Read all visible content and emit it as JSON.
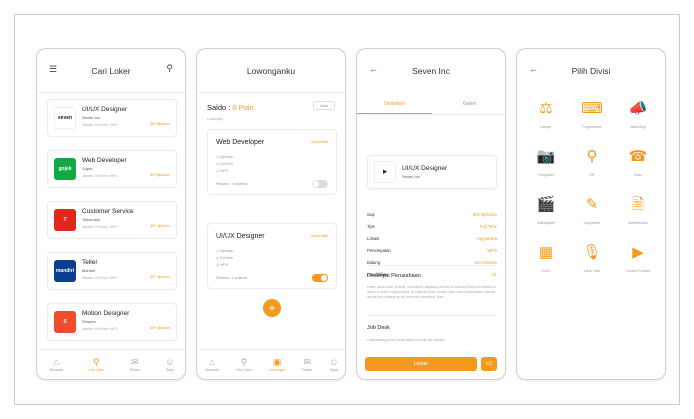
{
  "accent": "#f39a1e",
  "screen1": {
    "title": "Cari Loker",
    "filter_icon": "filter-icon",
    "search_icon": "search-icon",
    "jobs": [
      {
        "title": "UI/UX Designer",
        "company": "Seven Inc",
        "meta": "Jakarta  •  Full time  •  WFH",
        "salary": "IDR 5jt/bulan",
        "logo_color": "#ffffff",
        "logo_text": "seven"
      },
      {
        "title": "Web Developer",
        "company": "Gojek",
        "meta": "Jakarta  •  Full time  •  WFO",
        "salary": "IDR 8jt/bulan",
        "logo_color": "#12a843",
        "logo_text": "gojek"
      },
      {
        "title": "Customer Service",
        "company": "Telkomsel",
        "meta": "Jakarta  •  Full time  •  WFO",
        "salary": "IDR 4jt/bulan",
        "logo_color": "#e1261c",
        "logo_text": "T"
      },
      {
        "title": "Teller",
        "company": "Mandiri",
        "meta": "Jakarta  •  Full time  •  WFO",
        "salary": "IDR 4jt/bulan",
        "logo_color": "#0b3d91",
        "logo_text": "mandiri"
      },
      {
        "title": "Motion Designer",
        "company": "Shopee",
        "meta": "Jakarta  •  Full time  •  WFO",
        "salary": "IDR 6jt/bulan",
        "logo_color": "#ee4d2d",
        "logo_text": "S"
      }
    ],
    "nav": [
      "Beranda",
      "Cari Loker",
      "Pesan",
      "Saya"
    ]
  },
  "screen2": {
    "title": "Lowonganku",
    "saldo_label": "Saldo : ",
    "saldo_value": "0 Poin",
    "ubah_label": "Ubah",
    "section_label": "Lowongan",
    "vacancies": [
      {
        "title": "Web Developer",
        "status": "Lihat Detail",
        "rows": [
          "8jt/bulan",
          "Full time",
          "WFO"
        ],
        "footer": "Pelamar : 0 pelamar",
        "active": false
      },
      {
        "title": "UI/UX Designer",
        "status": "Lihat Detail",
        "rows": [
          "5jt/bulan",
          "Full time",
          "WFH"
        ],
        "footer": "Pelamar : 0 pelamar",
        "active": true
      }
    ],
    "fab": "+",
    "nav": [
      "Beranda",
      "Cari Loker",
      "Lowongan",
      "Pesan",
      "Saya"
    ]
  },
  "screen3": {
    "title": "Seven Inc",
    "tabs": [
      "Deskripsi",
      "Galeri"
    ],
    "job_title": "UI/UX Designer",
    "company": "Seven Inc",
    "details": [
      {
        "k": "Gaji",
        "v": "IDR 5jt/bulan"
      },
      {
        "k": "Tipe",
        "v": "Full Time"
      },
      {
        "k": "Lokasi",
        "v": "Yogyakarta"
      },
      {
        "k": "Penempatan",
        "v": "WFO"
      },
      {
        "k": "Bidang",
        "v": "Seni Desain"
      },
      {
        "k": "Pendidikan",
        "v": "S1"
      }
    ],
    "desc_title": "Deskripsi Perusahaan",
    "desc_text": "Lorem ipsum dolor sit amet, consectetur adipiscing elit sed do eiusmod tempor incididunt ut labore et dolore magna aliqua. Ut enim ad minim veniam, quis nostrud exercitation ullamco laboris nisi ut aliquip ex ea commodo consequat. Duis.",
    "job_desk_title": "Job Desk",
    "job_desk_item": "Merancang produk untuk aplikasi mobile dan website",
    "apply_label": "Lamar"
  },
  "screen4": {
    "title": "Pilih Divisi",
    "divisions": [
      {
        "label": "Lawyer",
        "icon": "gavel-icon",
        "glyph": "⚖"
      },
      {
        "label": "Programmer",
        "icon": "code-icon",
        "glyph": "⌨"
      },
      {
        "label": "Marketing",
        "icon": "megaphone-icon",
        "glyph": "📣"
      },
      {
        "label": "Fotografer",
        "icon": "camera-icon",
        "glyph": "📷"
      },
      {
        "label": "HR",
        "icon": "magnifier-icon",
        "glyph": "⚲"
      },
      {
        "label": "Host",
        "icon": "headset-icon",
        "glyph": "☎"
      },
      {
        "label": "Videografer",
        "icon": "clapper-icon",
        "glyph": "🎬"
      },
      {
        "label": "Copywriter",
        "icon": "chat-icon",
        "glyph": "✎"
      },
      {
        "label": "Administrasi",
        "icon": "document-icon",
        "glyph": "🗎"
      },
      {
        "label": "UI/UX",
        "icon": "layout-icon",
        "glyph": "▦"
      },
      {
        "label": "Voice Over",
        "icon": "microphone-icon",
        "glyph": "🎙"
      },
      {
        "label": "Content Creator",
        "icon": "monitor-play-icon",
        "glyph": "▶"
      }
    ]
  }
}
